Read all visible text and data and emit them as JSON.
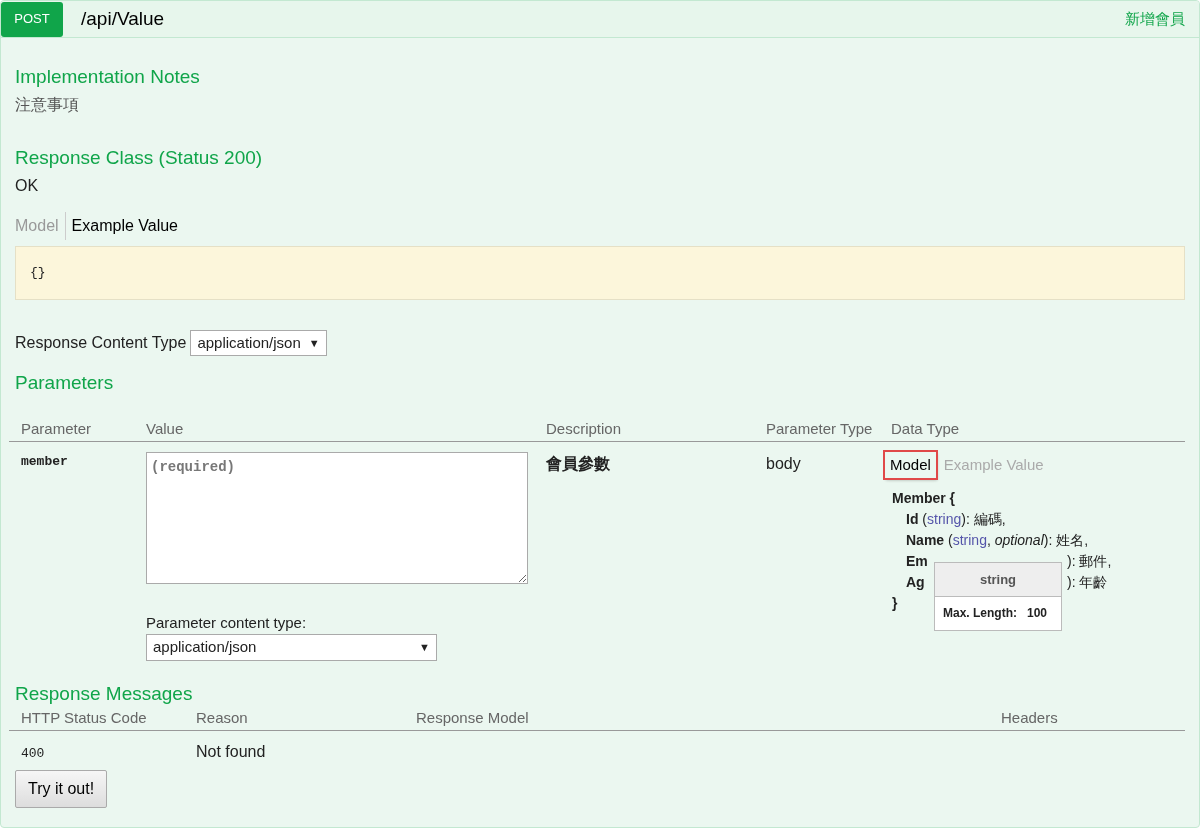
{
  "header": {
    "method": "POST",
    "path": "/api/Value",
    "summary": "新增會員"
  },
  "implementation_notes": {
    "title": "Implementation Notes",
    "text": "注意事項"
  },
  "response_class": {
    "title": "Response Class (Status 200)",
    "text": "OK",
    "tabs": [
      {
        "label": "Model",
        "selected": false
      },
      {
        "label": "Example Value",
        "selected": true
      }
    ],
    "example": "{}"
  },
  "response_content_type": {
    "label": "Response Content Type",
    "value": "application/json",
    "arrow": "▼"
  },
  "parameters": {
    "title": "Parameters",
    "columns": [
      "Parameter",
      "Value",
      "Description",
      "Parameter Type",
      "Data Type"
    ],
    "rows": [
      {
        "name": "member",
        "placeholder": "(required)",
        "content_type_label": "Parameter content type:",
        "content_type": "application/json",
        "content_type_arrow": "▼",
        "description": "會員參數",
        "type": "body",
        "data_type_tabs": [
          {
            "label": "Model",
            "selected": true,
            "highlighted": true
          },
          {
            "label": "Example Value",
            "selected": false,
            "highlighted": false
          }
        ],
        "model": {
          "open": "Member {",
          "close": "}",
          "properties": [
            {
              "kind": "full",
              "name": "Id",
              "open": " (",
              "type": "string",
              "desc": "): 編碼,"
            },
            {
              "kind": "full",
              "name": "Name",
              "open": " (",
              "type": "string",
              "sep": ", ",
              "optional": "optional",
              "desc": "): 姓名,"
            },
            {
              "kind": "covered",
              "name": "Em",
              "desc": "): 郵件,"
            },
            {
              "kind": "covered",
              "name": "Ag",
              "desc": "): 年齡"
            }
          ]
        },
        "tooltip": {
          "title": "string",
          "label": "Max. Length:",
          "value": "100"
        }
      }
    ]
  },
  "response_messages": {
    "title": "Response Messages",
    "columns": [
      "HTTP Status Code",
      "Reason",
      "Response Model",
      "Headers"
    ],
    "rows": [
      {
        "code": "400",
        "reason": "Not found"
      }
    ]
  },
  "try_button": "Try it out!"
}
